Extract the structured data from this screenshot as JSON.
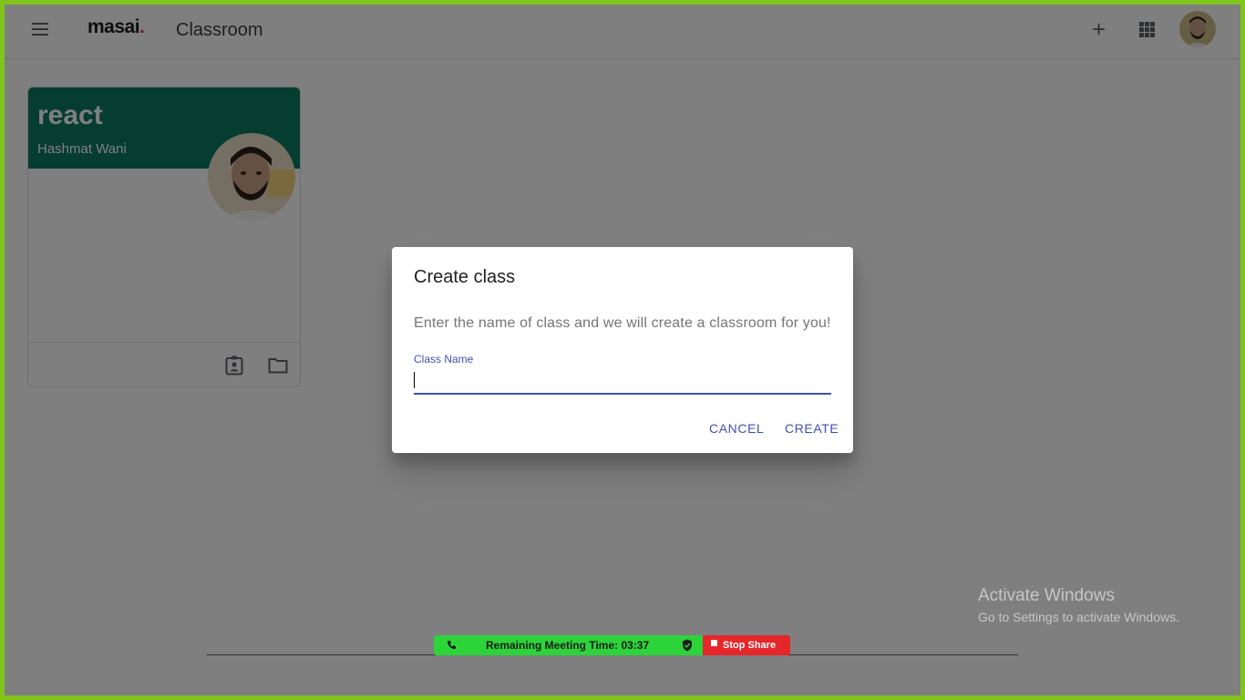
{
  "header": {
    "logo_text": "masai",
    "logo_dot": ".",
    "app_title": "Classroom",
    "add_label": "+"
  },
  "class_card": {
    "title": "react",
    "teacher": "Hashmat Wani"
  },
  "dialog": {
    "title": "Create class",
    "description": "Enter the name of class and we will create a classroom for you!",
    "field_label": "Class Name",
    "field_value": "",
    "cancel_label": "CANCEL",
    "create_label": "CREATE"
  },
  "watermark": {
    "line1": "Activate Windows",
    "line2": "Go to Settings to activate Windows."
  },
  "meeting_bar": {
    "remaining_time": "Remaining Meeting Time: 03:37",
    "stop_share_label": "Stop Share"
  },
  "colors": {
    "accent": "#3f51b5",
    "card_header": "#0b7a63",
    "desktop_border": "#80c41c",
    "meeting_green": "#2cd43a",
    "stop_red": "#e5262a"
  },
  "icons": {
    "menu": "menu-icon",
    "add": "plus-icon",
    "apps": "apps-grid-icon",
    "assignments": "assignment-ind-icon",
    "folder": "folder-icon",
    "phone": "phone-icon",
    "shield": "shield-check-icon",
    "stop": "stop-square-icon"
  }
}
